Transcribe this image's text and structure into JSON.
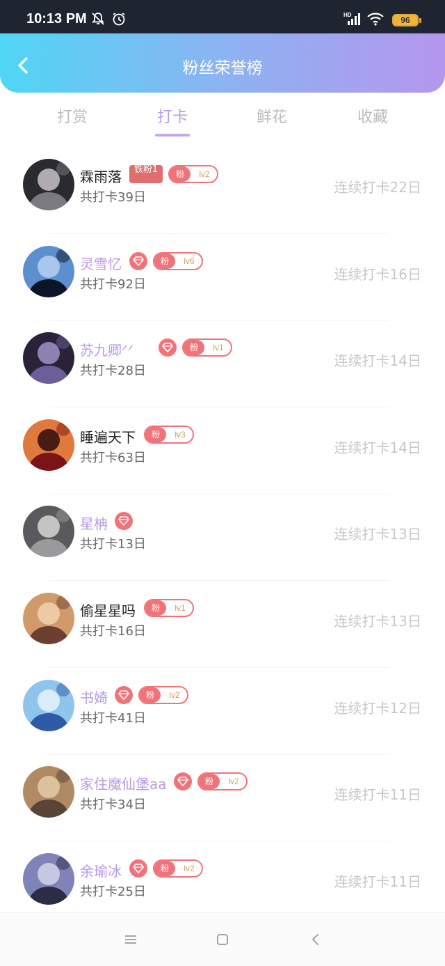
{
  "status_bar": {
    "time": "10:13 PM",
    "battery": "96"
  },
  "header": {
    "title": "粉丝荣誉榜"
  },
  "tabs": [
    {
      "label": "打赏",
      "active": false
    },
    {
      "label": "打卡",
      "active": true
    },
    {
      "label": "鲜花",
      "active": false
    },
    {
      "label": "收藏",
      "active": false
    }
  ],
  "fan_badge_prefix": "粉",
  "iron_fan_label": "铁粉1",
  "rows": [
    {
      "name": "霖雨落",
      "vip": false,
      "iron_fan": true,
      "level": "lv2",
      "total": "共打卡39日",
      "streak": "连续打卡22日",
      "avatar_palette": [
        "#7a7a80",
        "#2a2a30",
        "#c9c2c7"
      ]
    },
    {
      "name": "灵雪忆",
      "vip": true,
      "iron_fan": false,
      "level": "lv6",
      "total": "共打卡92日",
      "streak": "连续打卡16日",
      "avatar_palette": [
        "#0c1428",
        "#5d8fcf",
        "#b7d0ef"
      ]
    },
    {
      "name": "苏九卿ᐟᐟ",
      "vip": true,
      "iron_fan": false,
      "level": "lv1",
      "total": "共打卡28日",
      "streak": "连续打卡14日",
      "avatar_palette": [
        "#6b5f9a",
        "#2a2238",
        "#9d93c7"
      ]
    },
    {
      "name": "睡遍天下",
      "vip": false,
      "iron_fan": false,
      "level": "lv3",
      "total": "共打卡63日",
      "streak": "连续打卡14日",
      "avatar_palette": [
        "#7a1418",
        "#e07a3c",
        "#2a0c0c"
      ]
    },
    {
      "name": "星柟",
      "vip": true,
      "iron_fan": false,
      "level": "",
      "total": "共打卡13日",
      "streak": "连续打卡13日",
      "avatar_palette": [
        "#9a9a9c",
        "#5a5a5e",
        "#d8d6d4"
      ]
    },
    {
      "name": "偷星星吗",
      "vip": false,
      "iron_fan": false,
      "level": "lv1",
      "total": "共打卡16日",
      "streak": "连续打卡13日",
      "avatar_palette": [
        "#6b4030",
        "#d09a6a",
        "#f2d2b0"
      ]
    },
    {
      "name": "书婍",
      "vip": true,
      "iron_fan": false,
      "level": "lv2",
      "total": "共打卡41日",
      "streak": "连续打卡12日",
      "avatar_palette": [
        "#2f5aa8",
        "#8fc4ec",
        "#e8f2fb"
      ]
    },
    {
      "name": "家住魔仙堡aa",
      "vip": true,
      "iron_fan": false,
      "level": "lv2",
      "total": "共打卡34日",
      "streak": "连续打卡11日",
      "avatar_palette": [
        "#5a4438",
        "#b08a62",
        "#e2cba8"
      ]
    },
    {
      "name": "余瑜冰",
      "vip": true,
      "iron_fan": false,
      "level": "lv2",
      "total": "共打卡25日",
      "streak": "连续打卡11日",
      "avatar_palette": [
        "#2c2c44",
        "#7f83b8",
        "#d2d4e8"
      ]
    }
  ]
}
